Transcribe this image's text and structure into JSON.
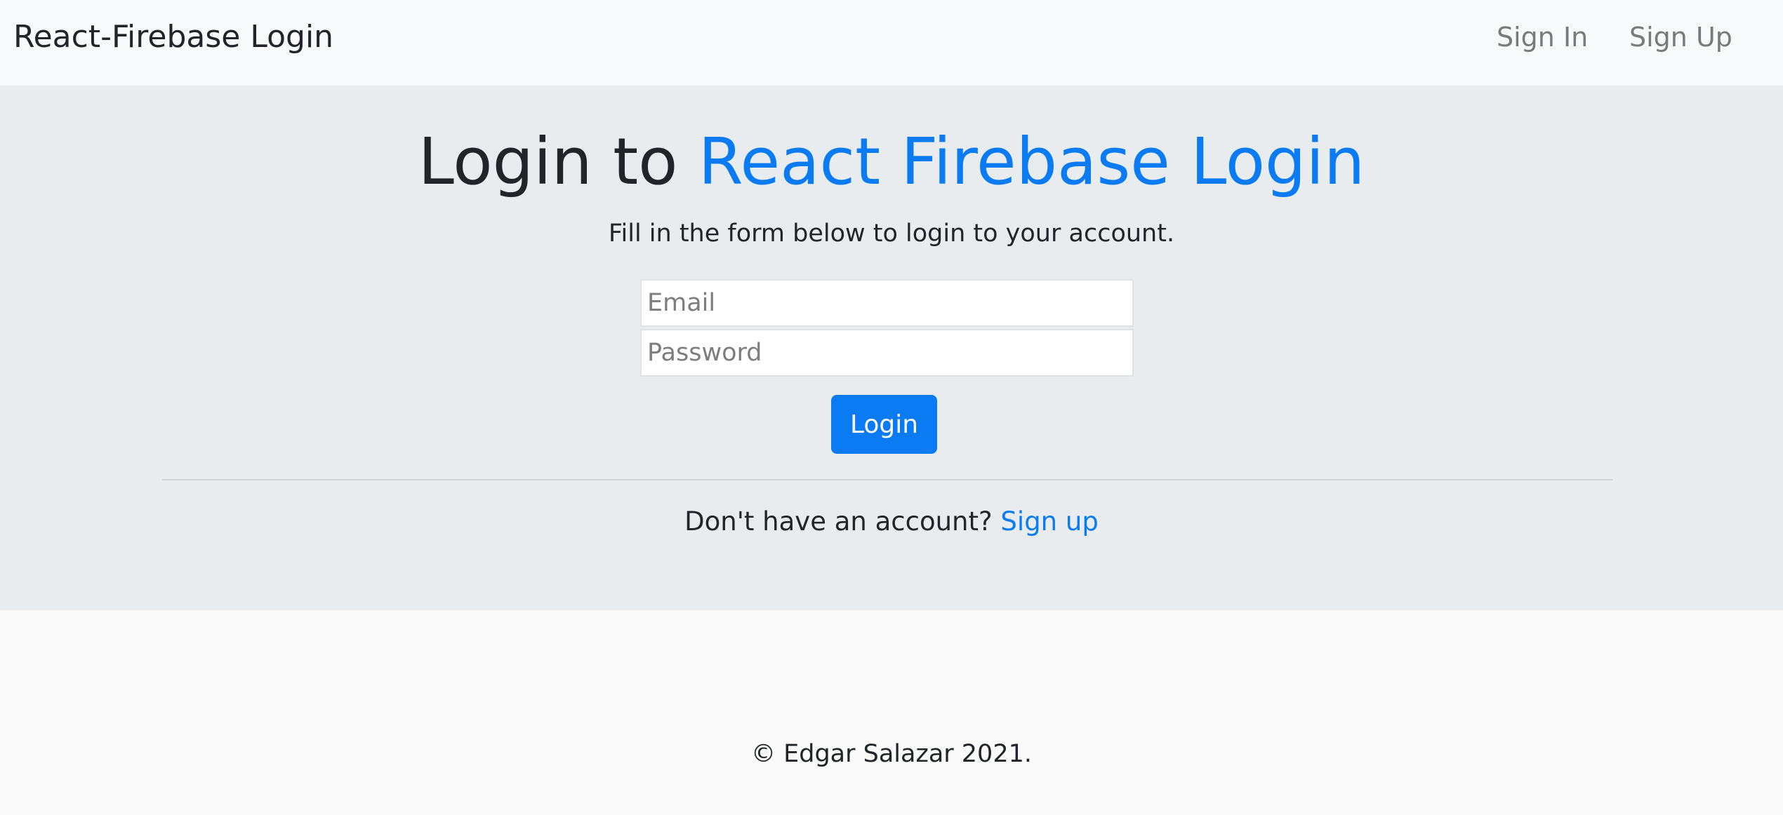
{
  "navbar": {
    "brand": "React-Firebase Login",
    "links": [
      {
        "label": "Sign In"
      },
      {
        "label": "Sign Up"
      }
    ]
  },
  "login": {
    "title_prefix": "Login to ",
    "title_accent": "React Firebase Login",
    "lead": "Fill in the form below to login to your account.",
    "email": {
      "placeholder": "Email",
      "value": ""
    },
    "password": {
      "placeholder": "Password",
      "value": ""
    },
    "submit_label": "Login",
    "signup_prompt": "Don't have an account? ",
    "signup_link": "Sign up"
  },
  "footer": {
    "copyright": "© Edgar Salazar 2021."
  },
  "colors": {
    "accent": "#0b7bf3",
    "navbar_bg": "#f8f9fa",
    "jumbotron_bg": "#e9ecef",
    "page_bg": "#fafafa",
    "text": "#212529",
    "nav_link": "#7a7a7a"
  }
}
